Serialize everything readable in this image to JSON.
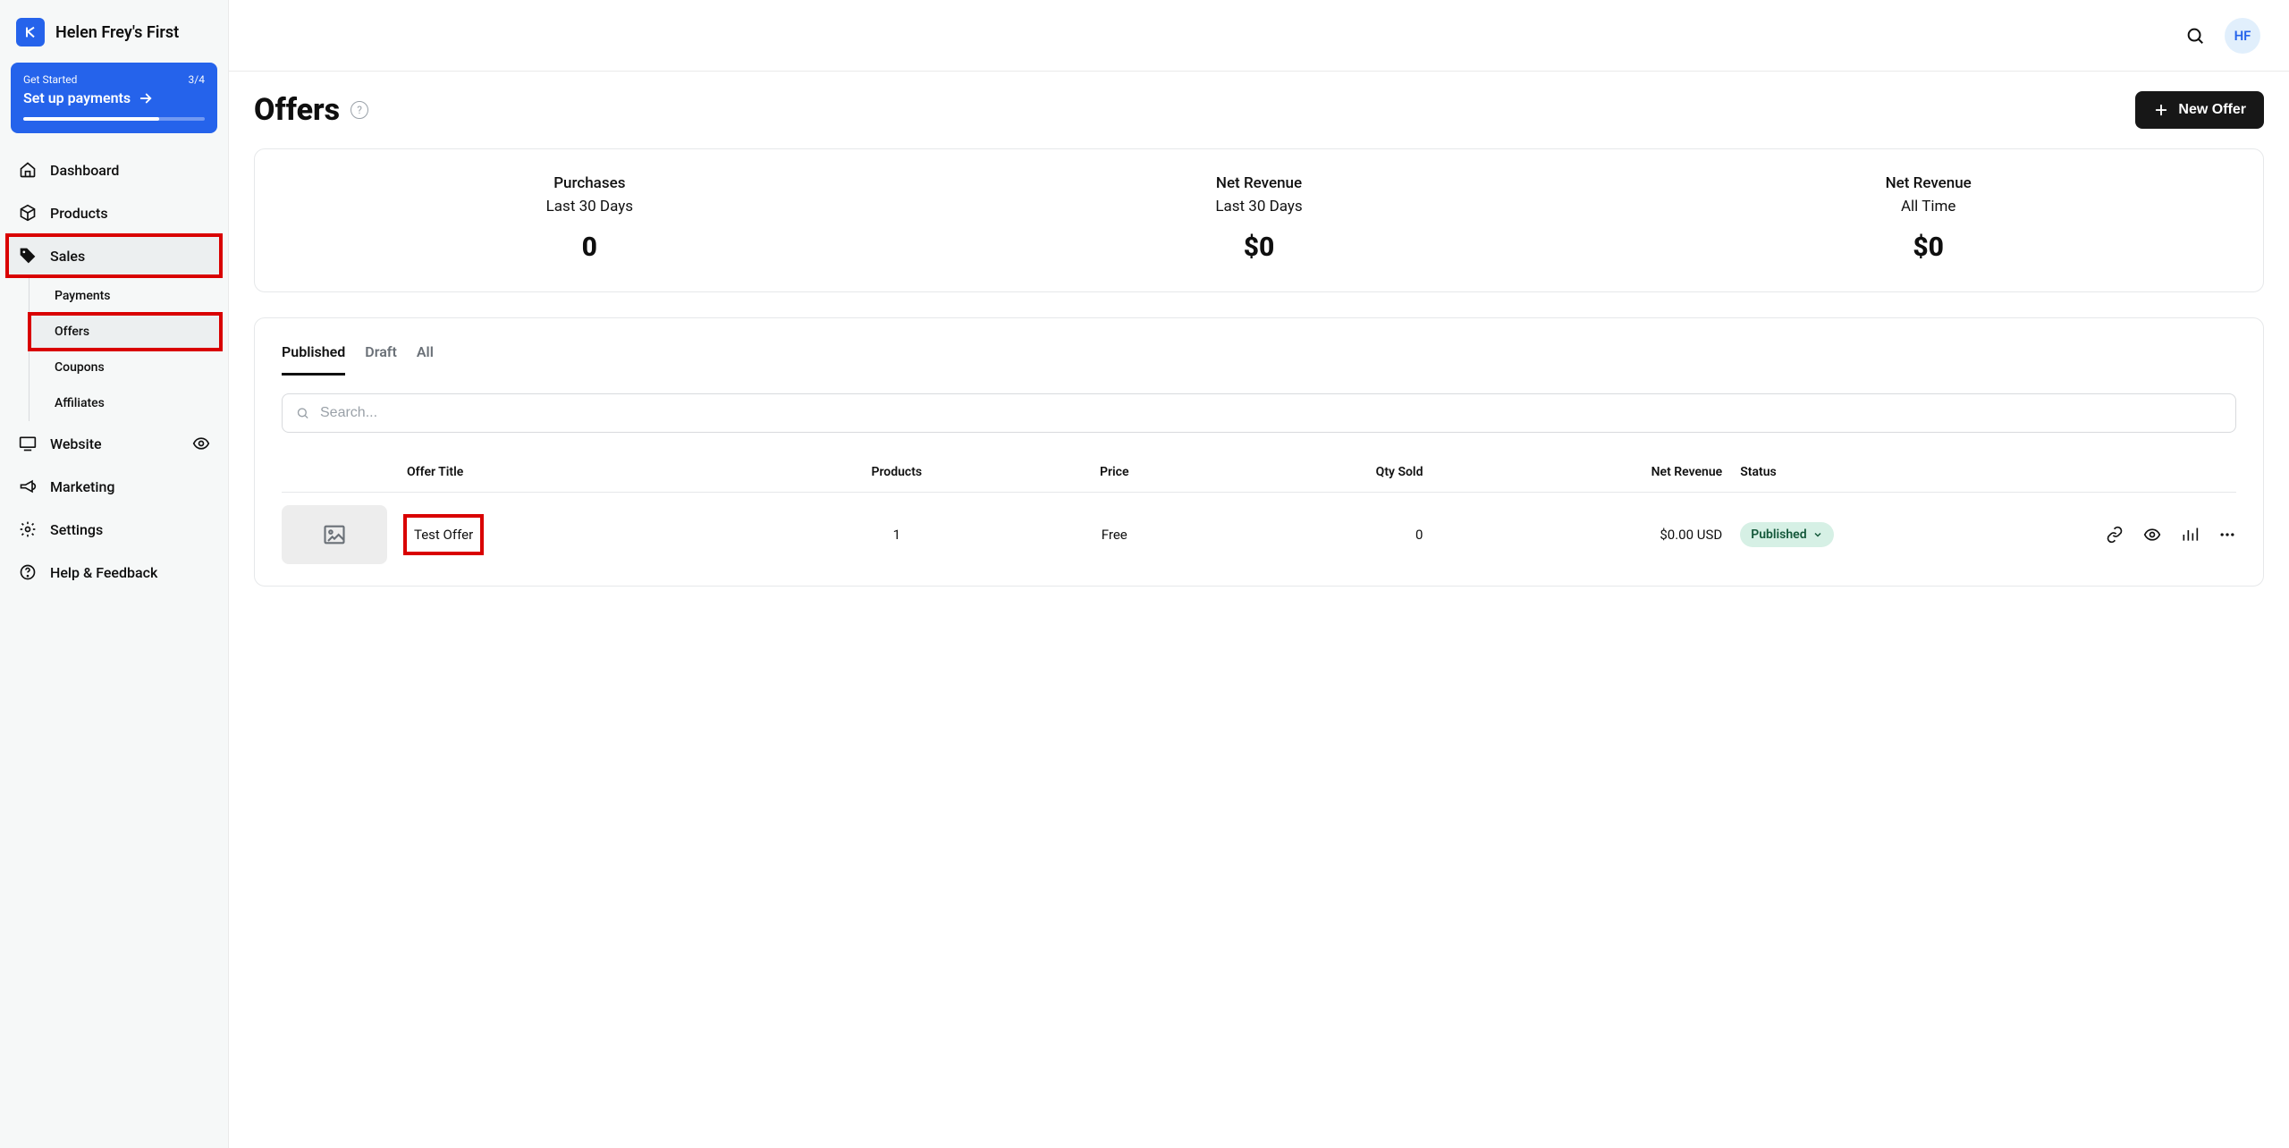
{
  "brand": {
    "title": "Helen Frey's First"
  },
  "get_started": {
    "label": "Get Started",
    "progress": "3/4",
    "action": "Set up payments"
  },
  "nav": {
    "dashboard": "Dashboard",
    "products": "Products",
    "sales": "Sales",
    "website": "Website",
    "marketing": "Marketing",
    "settings": "Settings",
    "help": "Help & Feedback"
  },
  "subnav": {
    "payments": "Payments",
    "offers": "Offers",
    "coupons": "Coupons",
    "affiliates": "Affiliates"
  },
  "topbar": {
    "avatar": "HF"
  },
  "page": {
    "title": "Offers",
    "new_offer": "New Offer"
  },
  "stats": [
    {
      "title": "Purchases",
      "sub": "Last 30 Days",
      "value": "0"
    },
    {
      "title": "Net Revenue",
      "sub": "Last 30 Days",
      "value": "$0"
    },
    {
      "title": "Net Revenue",
      "sub": "All Time",
      "value": "$0"
    }
  ],
  "tabs": {
    "published": "Published",
    "draft": "Draft",
    "all": "All"
  },
  "search": {
    "placeholder": "Search..."
  },
  "table": {
    "headers": {
      "offer_title": "Offer Title",
      "products": "Products",
      "price": "Price",
      "qty_sold": "Qty Sold",
      "net_revenue": "Net Revenue",
      "status": "Status"
    },
    "rows": [
      {
        "offer_title": "Test Offer",
        "products": "1",
        "price": "Free",
        "qty_sold": "0",
        "net_revenue": "$0.00 USD",
        "status": "Published"
      }
    ]
  }
}
